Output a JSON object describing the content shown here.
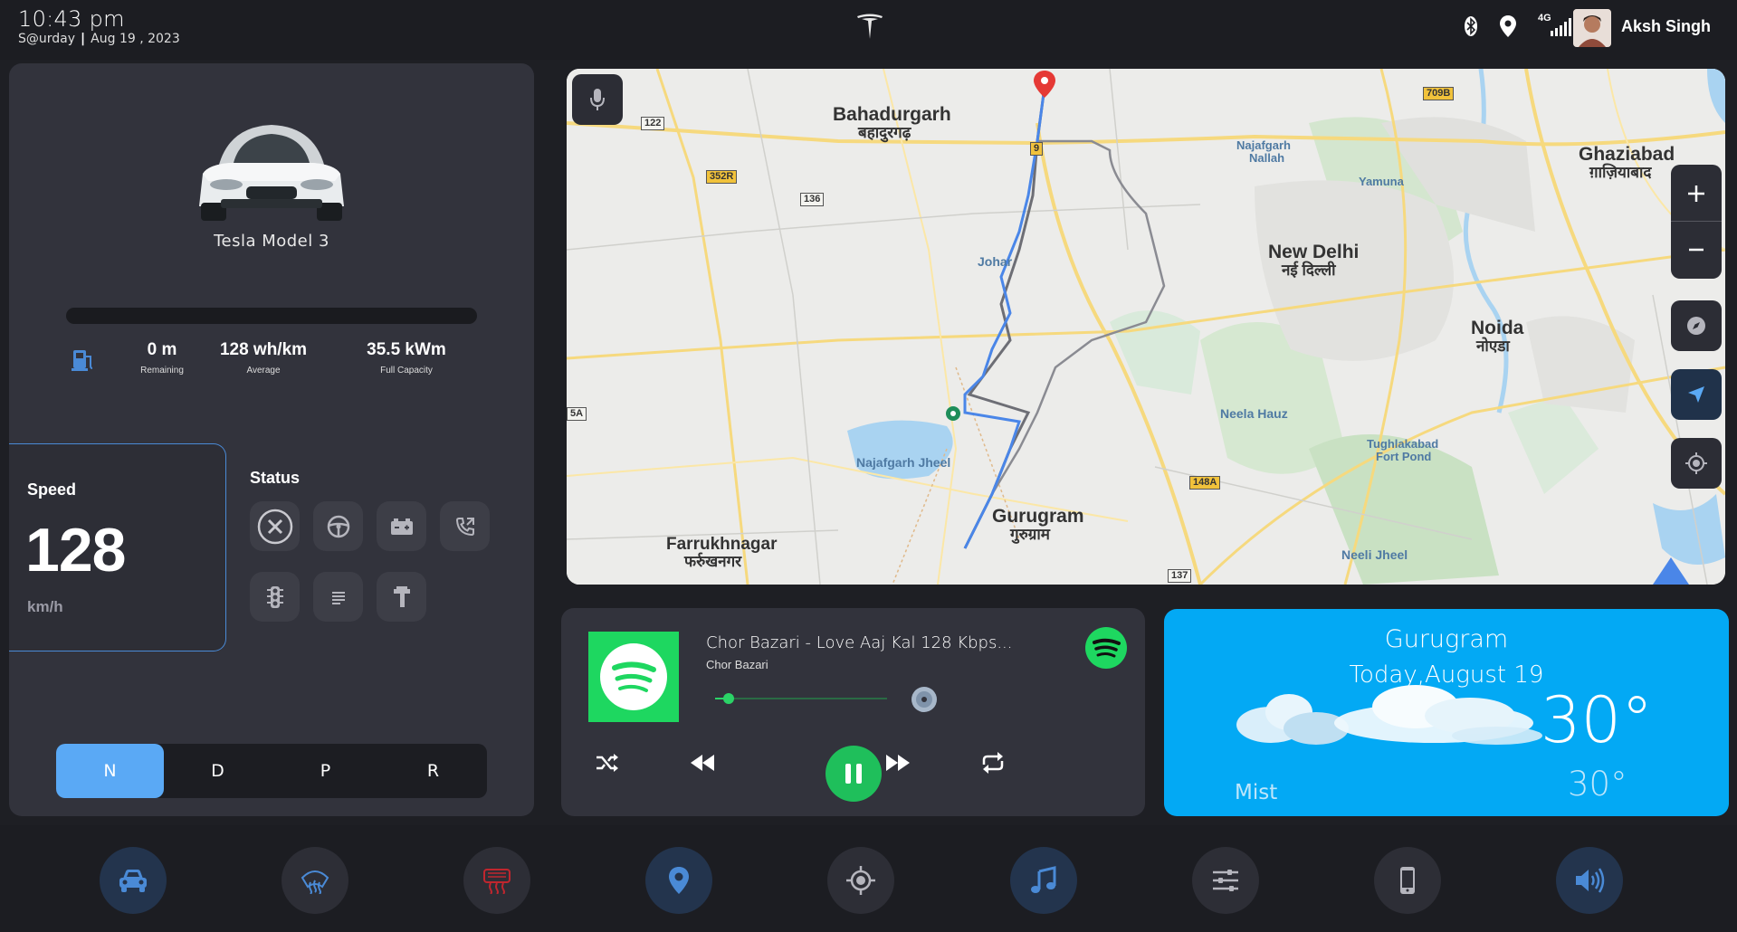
{
  "topbar": {
    "time": "10:43 pm",
    "day": "S@urday",
    "date": "Aug 19 , 2023",
    "network": "4G",
    "user_name": "Aksh Singh",
    "icons": [
      "bluetooth-icon",
      "location-icon",
      "signal-icon"
    ]
  },
  "vehicle": {
    "model": "Tesla Model 3",
    "battery_level": 0,
    "stats": [
      {
        "value": "0 m",
        "label": "Remaining"
      },
      {
        "value": "128 wh/km",
        "label": "Average"
      },
      {
        "value": "35.5 kWm",
        "label": "Full Capacity"
      }
    ],
    "speed_label": "Speed",
    "speed": "128",
    "speed_unit": "km/h",
    "status_title": "Status",
    "status_icons": [
      "close-circle-icon",
      "steering-wheel-icon",
      "battery-icon",
      "phone-forward-icon",
      "traffic-light-icon",
      "lines-icon",
      "seat-icon"
    ],
    "gears": [
      "N",
      "D",
      "P",
      "R"
    ],
    "active_gear": "N"
  },
  "map": {
    "labels": {
      "bahadurgarh": "Bahadurgarh",
      "bahadurgarh_hi": "बहादुरगढ़",
      "najafgarh_nallah_1": "Najafgarh",
      "najafgarh_nallah_2": "Nallah",
      "yamuna": "Yamuna",
      "ghaziabad": "Ghaziabad",
      "ghaziabad_hi": "ग़ाज़ियाबाद",
      "johar": "Johar",
      "new_delhi": "New Delhi",
      "new_delhi_hi": "नई दिल्ली",
      "noida": "Noida",
      "noida_hi": "नोएडा",
      "neela_hauz": "Neela Hauz",
      "najafgarh_jheel": "Najafgarh Jheel",
      "tughlakabad_1": "Tughlakabad",
      "tughlakabad_2": "Fort Pond",
      "gurugram": "Gurugram",
      "gurugram_hi": "गुरुग्राम",
      "farrukhnagar": "Farrukhnagar",
      "farrukhnagar_hi": "फर्रुखनगर",
      "neeli_jheel": "Neeli Jheel"
    },
    "roads": {
      "r122": "122",
      "r352r": "352R",
      "r136": "136",
      "r9": "9",
      "r709b": "709B",
      "r5a": "5A",
      "r148a": "148A",
      "r137": "137"
    },
    "controls": [
      "zoom-in-icon",
      "zoom-out-icon",
      "compass-icon",
      "navigate-icon",
      "my-location-icon"
    ]
  },
  "music": {
    "title": "Chor Bazari - Love Aaj Kal 128 Kbps...",
    "artist": "Chor Bazari",
    "progress": 0.08
  },
  "weather": {
    "city": "Gurugram",
    "date": "Today,August 19",
    "temp": "30°",
    "condition": "Mist",
    "low": "30°"
  },
  "dock": [
    "car-icon",
    "front-defrost-icon",
    "rear-defrost-icon",
    "location-pin-icon",
    "target-icon",
    "music-note-icon",
    "sliders-icon",
    "phone-icon",
    "volume-icon"
  ],
  "colors": {
    "accent": "#3b8ef0",
    "spotify": "#1ed760",
    "weather_bg": "#03a9f4",
    "panel": "#32333c"
  }
}
